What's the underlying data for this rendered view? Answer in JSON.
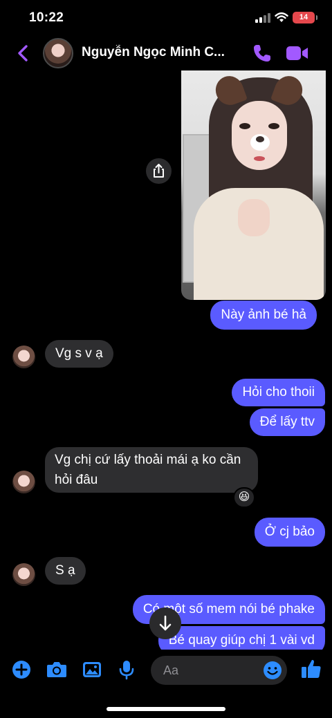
{
  "status_bar": {
    "time": "10:22",
    "battery": "14"
  },
  "header": {
    "contact_name": "Nguyễn Ngọc Minh C..."
  },
  "messages": [
    {
      "id": "m1",
      "direction": "out",
      "text": "Này ảnh bé hả"
    },
    {
      "id": "m2",
      "direction": "in",
      "text": "Vg s v ạ"
    },
    {
      "id": "m3",
      "direction": "out",
      "text": "Hỏi cho thoii"
    },
    {
      "id": "m4",
      "direction": "out",
      "text": "Để lấy ttv"
    },
    {
      "id": "m5",
      "direction": "in",
      "lines": [
        "Vg chị cứ lấy thoải mái ạ ko cần",
        "hỏi đâu"
      ],
      "reaction": "😆"
    },
    {
      "id": "m6",
      "direction": "out",
      "text": "Ở cj bảo"
    },
    {
      "id": "m7",
      "direction": "in",
      "text": "S ạ"
    },
    {
      "id": "m8",
      "direction": "out",
      "text": "Có một số mem nói bé phake"
    },
    {
      "id": "m9",
      "direction": "out",
      "text": "Bé quay giúp chị 1 vài vd"
    }
  ],
  "composer": {
    "placeholder": "Aa"
  },
  "colors": {
    "accent": "#5a5bff",
    "icon": "#2d8cff",
    "header_icon": "#a259ff",
    "incoming": "#2e2e30"
  },
  "icons": [
    "back-icon",
    "call-icon",
    "video-call-icon",
    "share-icon",
    "arrow-down-icon",
    "plus-icon",
    "camera-icon",
    "gallery-icon",
    "microphone-icon",
    "emoji-icon",
    "like-icon"
  ]
}
